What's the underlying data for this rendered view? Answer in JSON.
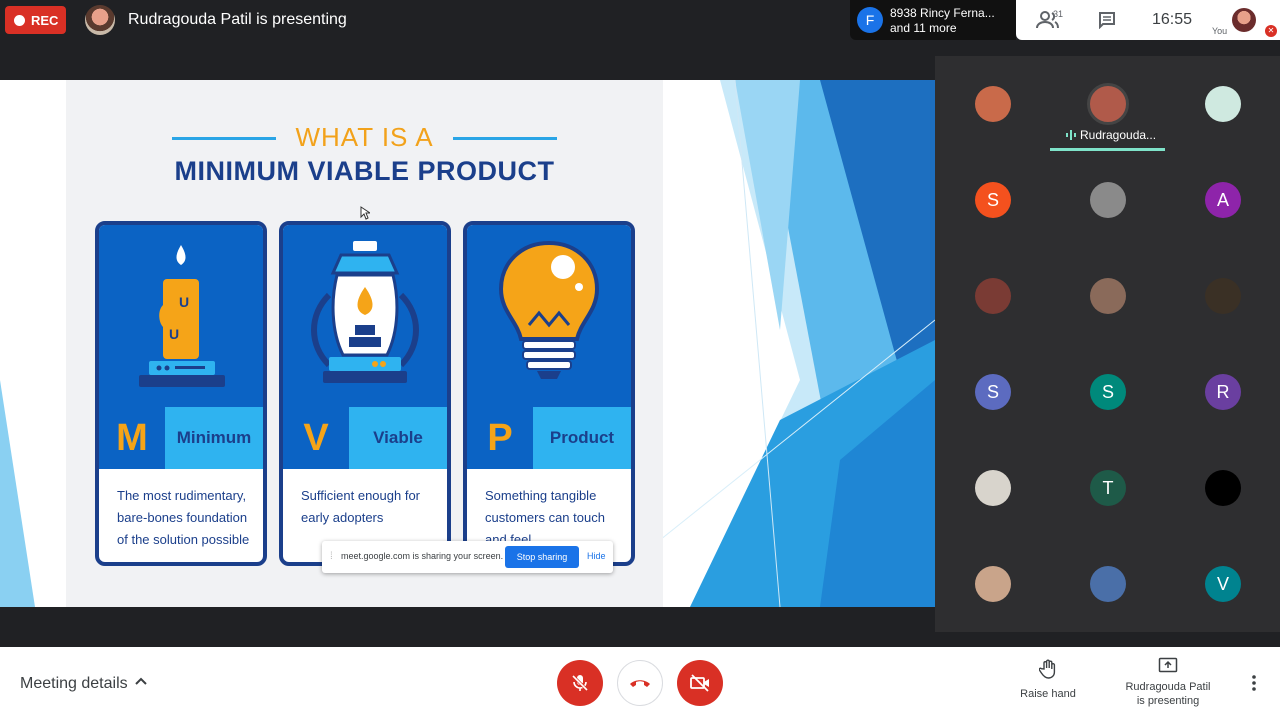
{
  "header": {
    "rec_label": "REC",
    "presenter_title": "Rudragouda Patil is presenting",
    "participants_chip": {
      "initial": "F",
      "line1": "8938 Rincy Ferna...",
      "line2": "and 11 more"
    },
    "people_count": "31",
    "time": "16:55",
    "self_label": "You"
  },
  "slide": {
    "heading_line1": "WHAT IS A",
    "heading_line2": "MINIMUM VIABLE PRODUCT",
    "columns": [
      {
        "letter": "M",
        "word": "Minimum",
        "description": "The most rudimentary, bare-bones foundation of the solution possible"
      },
      {
        "letter": "V",
        "word": "Viable",
        "description": "Sufficient enough for early adopters"
      },
      {
        "letter": "P",
        "word": "Product",
        "description": "Something tangible customers can touch and feel"
      }
    ]
  },
  "share_notice": {
    "text": "meet.google.com is sharing your screen.",
    "stop_label": "Stop sharing",
    "hide_label": "Hide"
  },
  "participants": [
    {
      "initial": "",
      "color": "#c96a4a",
      "name": ""
    },
    {
      "initial": "",
      "color": "#b05a4a",
      "name": "Rudragouda...",
      "speaking": true
    },
    {
      "initial": "",
      "color": "#cfe9e0",
      "name": ""
    },
    {
      "initial": "S",
      "color": "#f4511e",
      "name": ""
    },
    {
      "initial": "",
      "color": "#8a8a8a",
      "name": ""
    },
    {
      "initial": "A",
      "color": "#8e24aa",
      "name": ""
    },
    {
      "initial": "",
      "color": "#7a3b34",
      "name": ""
    },
    {
      "initial": "",
      "color": "#8a6a5a",
      "name": ""
    },
    {
      "initial": "",
      "color": "#3a3025",
      "name": ""
    },
    {
      "initial": "S",
      "color": "#5c6bc0",
      "name": ""
    },
    {
      "initial": "S",
      "color": "#00897b",
      "name": ""
    },
    {
      "initial": "R",
      "color": "#6a3fa0",
      "name": ""
    },
    {
      "initial": "",
      "color": "#d8d4cc",
      "name": ""
    },
    {
      "initial": "T",
      "color": "#1e5a48",
      "name": ""
    },
    {
      "initial": "",
      "color": "#000000",
      "name": ""
    },
    {
      "initial": "",
      "color": "#c9a48a",
      "name": ""
    },
    {
      "initial": "",
      "color": "#4a6fa8",
      "name": ""
    },
    {
      "initial": "V",
      "color": "#00838f",
      "name": ""
    }
  ],
  "footer": {
    "meeting_details": "Meeting details",
    "raise_hand": "Raise hand",
    "presenting_line1": "Rudragouda Patil",
    "presenting_line2": "is presenting"
  },
  "colors": {
    "accent": "#1a73e8",
    "danger": "#d93025",
    "slide_navy": "#1b3f8b",
    "slide_orange": "#f2a21b",
    "slide_blue": "#0b63c4"
  }
}
